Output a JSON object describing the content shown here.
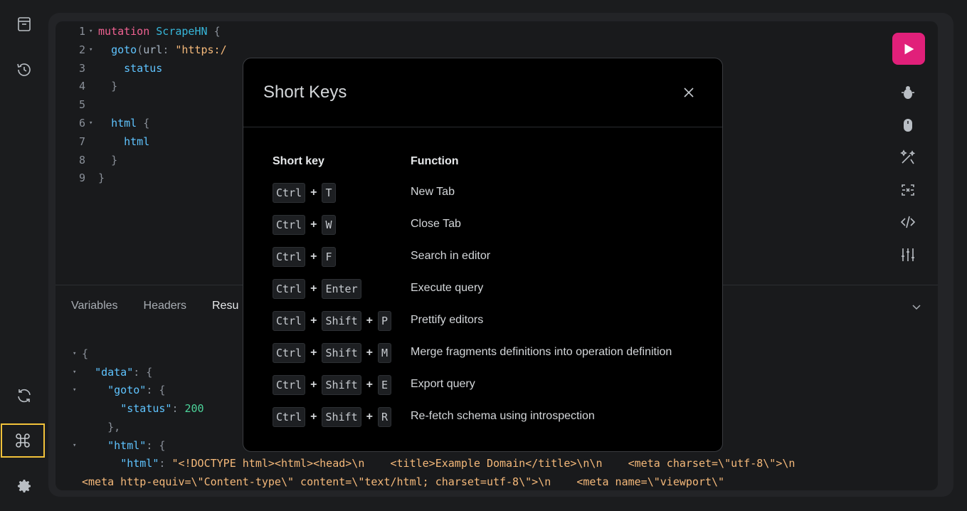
{
  "sidebar": {
    "items": [
      {
        "icon": "docs-icon",
        "label": "Docs"
      },
      {
        "icon": "history-icon",
        "label": "History"
      },
      {
        "icon": "refresh-icon",
        "label": "Re-fetch schema"
      },
      {
        "icon": "command-icon",
        "label": "Short keys",
        "active": true
      },
      {
        "icon": "settings-icon",
        "label": "Settings"
      }
    ]
  },
  "editor": {
    "lines": [
      {
        "n": "1",
        "fold": true,
        "parts": [
          [
            "kw",
            "mutation"
          ],
          [
            "sp",
            " "
          ],
          [
            "nm",
            "ScrapeHN"
          ],
          [
            "sp",
            " "
          ],
          [
            "pun",
            "{"
          ]
        ]
      },
      {
        "n": "2",
        "fold": true,
        "parts": [
          [
            "sp",
            "  "
          ],
          [
            "fld",
            "goto"
          ],
          [
            "pun",
            "("
          ],
          [
            "arg",
            "url"
          ],
          [
            "pun",
            ":"
          ],
          [
            "sp",
            " "
          ],
          [
            "str",
            "\"https:/"
          ]
        ]
      },
      {
        "n": "3",
        "fold": false,
        "parts": [
          [
            "sp",
            "    "
          ],
          [
            "fld",
            "status"
          ]
        ]
      },
      {
        "n": "4",
        "fold": false,
        "parts": [
          [
            "sp",
            "  "
          ],
          [
            "pun",
            "}"
          ]
        ]
      },
      {
        "n": "5",
        "fold": false,
        "parts": []
      },
      {
        "n": "6",
        "fold": true,
        "parts": [
          [
            "sp",
            "  "
          ],
          [
            "fld",
            "html"
          ],
          [
            "sp",
            " "
          ],
          [
            "pun",
            "{"
          ]
        ]
      },
      {
        "n": "7",
        "fold": false,
        "parts": [
          [
            "sp",
            "    "
          ],
          [
            "fld",
            "html"
          ]
        ]
      },
      {
        "n": "8",
        "fold": false,
        "parts": [
          [
            "sp",
            "  "
          ],
          [
            "pun",
            "}"
          ]
        ]
      },
      {
        "n": "9",
        "fold": false,
        "parts": [
          [
            "pun",
            "}"
          ]
        ]
      }
    ]
  },
  "toolbar": {
    "run_icon": "play-icon",
    "tools": [
      "bug-icon",
      "mouse-icon",
      "magic-wand-icon",
      "screenshot-icon",
      "code-icon",
      "sliders-icon"
    ]
  },
  "bottom_tabs": [
    {
      "label": "Variables",
      "active": false
    },
    {
      "label": "Headers",
      "active": false
    },
    {
      "label": "Resu",
      "active": true
    }
  ],
  "result": {
    "lines": [
      {
        "parts": [
          [
            "pun",
            "{"
          ]
        ]
      },
      {
        "parts": [
          [
            "sp",
            "  "
          ],
          [
            "fld",
            "\"data\""
          ],
          [
            "pun",
            ": {"
          ]
        ]
      },
      {
        "parts": [
          [
            "sp",
            "    "
          ],
          [
            "fld",
            "\"goto\""
          ],
          [
            "pun",
            ": {"
          ]
        ]
      },
      {
        "parts": [
          [
            "sp",
            "      "
          ],
          [
            "fld",
            "\"status\""
          ],
          [
            "pun",
            ": "
          ],
          [
            "num",
            "200"
          ]
        ]
      },
      {
        "parts": [
          [
            "sp",
            "    "
          ],
          [
            "pun",
            "},"
          ]
        ]
      },
      {
        "parts": [
          [
            "sp",
            "    "
          ],
          [
            "fld",
            "\"html\""
          ],
          [
            "pun",
            ": {"
          ]
        ]
      },
      {
        "parts": [
          [
            "sp",
            "      "
          ],
          [
            "fld",
            "\"html\""
          ],
          [
            "pun",
            ": "
          ],
          [
            "str",
            "\"<!DOCTYPE html><html><head>\\n    <title>Example Domain</title>\\n\\n    <meta charset=\\\"utf-8\\\">\\n"
          ]
        ]
      },
      {
        "parts": [
          [
            "str",
            "<meta http-equiv=\\\"Content-type\\\" content=\\\"text/html; charset=utf-8\\\">\\n    <meta name=\\\"viewport\\\""
          ]
        ]
      }
    ]
  },
  "modal": {
    "title": "Short Keys",
    "close_icon": "close-icon",
    "col_key": "Short key",
    "col_fn": "Function",
    "rows": [
      {
        "keys": [
          "Ctrl",
          "T"
        ],
        "fn": "New Tab"
      },
      {
        "keys": [
          "Ctrl",
          "W"
        ],
        "fn": "Close Tab"
      },
      {
        "keys": [
          "Ctrl",
          "F"
        ],
        "fn": "Search in editor"
      },
      {
        "keys": [
          "Ctrl",
          "Enter"
        ],
        "fn": "Execute query"
      },
      {
        "keys": [
          "Ctrl",
          "Shift",
          "P"
        ],
        "fn": "Prettify editors"
      },
      {
        "keys": [
          "Ctrl",
          "Shift",
          "M"
        ],
        "fn": "Merge fragments definitions into operation definition"
      },
      {
        "keys": [
          "Ctrl",
          "Shift",
          "E"
        ],
        "fn": "Export query"
      },
      {
        "keys": [
          "Ctrl",
          "Shift",
          "R"
        ],
        "fn": "Re-fetch schema using introspection"
      }
    ]
  },
  "colors": {
    "accent": "#e1207a",
    "highlight": "#f2c23a"
  }
}
